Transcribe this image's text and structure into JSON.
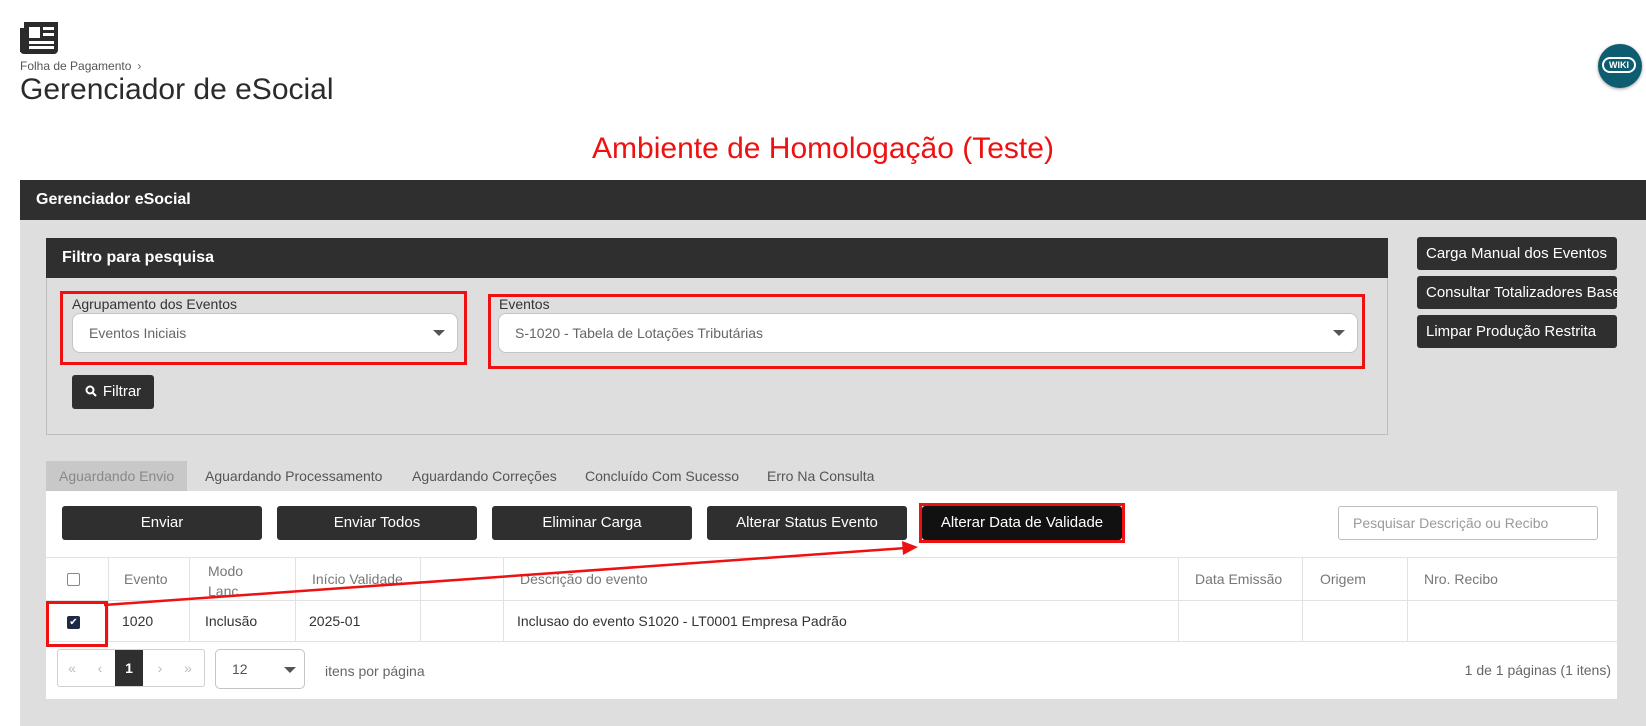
{
  "header": {
    "app_icon": "newspaper-icon",
    "breadcrumb": "Folha de Pagamento",
    "title": "Gerenciador de eSocial",
    "wiki_label": "WIKI"
  },
  "banner": "Ambiente de Homologação (Teste)",
  "panel": {
    "title": "Gerenciador eSocial"
  },
  "filter": {
    "title": "Filtro para pesquisa",
    "group_label": "Agrupamento dos Eventos",
    "group_value": "Eventos Iniciais",
    "events_label": "Eventos",
    "events_value": "S-1020 - Tabela de Lotações Tributárias",
    "filter_button": "Filtrar"
  },
  "side_buttons": {
    "manual_load": "Carga Manual dos Eventos",
    "totalizers": "Consultar Totalizadores Base",
    "clear": "Limpar Produção Restrita"
  },
  "tabs": [
    "Aguardando Envio",
    "Aguardando Processamento",
    "Aguardando Correções",
    "Concluído Com Sucesso",
    "Erro Na Consulta"
  ],
  "actions": {
    "send": "Enviar",
    "send_all": "Enviar Todos",
    "delete_load": "Eliminar Carga",
    "change_status": "Alterar Status Evento",
    "change_validity": "Alterar Data de Validade",
    "search_placeholder": "Pesquisar Descrição ou Recibo"
  },
  "table": {
    "columns": {
      "event": "Evento",
      "mode": "Modo Lanc.",
      "start": "Início Validade",
      "description": "Descrição do evento",
      "emission": "Data Emissão",
      "origin": "Origem",
      "receipt": "Nro. Recibo"
    },
    "rows": [
      {
        "checked": true,
        "event": "1020",
        "mode": "Inclusão",
        "start": "2025-01",
        "description": "Inclusao do evento S1020 - LT0001 Empresa Padrão",
        "emission": "",
        "origin": "",
        "receipt": ""
      }
    ]
  },
  "pagination": {
    "current_page": "1",
    "page_size": "12",
    "per_page_label": "itens por página",
    "summary": "1 de 1 páginas (1 itens)"
  },
  "colors": {
    "dark": "#2f2f2f",
    "annotation_red": "#ee1111",
    "panel_bg": "#dedede"
  }
}
